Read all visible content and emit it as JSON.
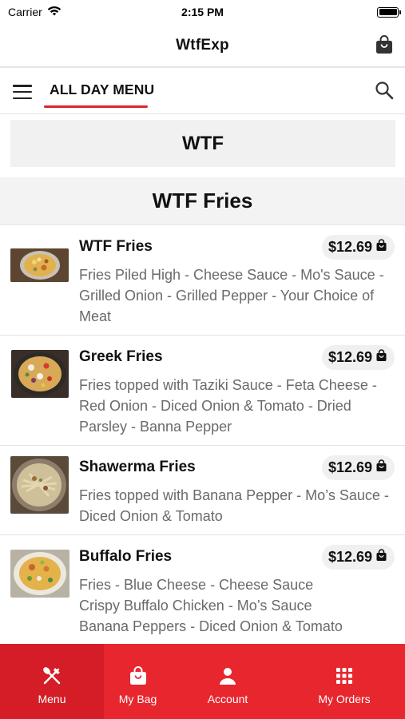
{
  "status_bar": {
    "carrier": "Carrier",
    "time": "2:15 PM",
    "battery_level": 1.0
  },
  "header": {
    "title": "WtfExp",
    "bag_icon": "shopping-bag-icon"
  },
  "menu_bar": {
    "menu_icon": "hamburger-icon",
    "tab_label": "ALL DAY MENU",
    "search_icon": "search-icon"
  },
  "category": {
    "title": "WTF"
  },
  "subcategory": {
    "title": "WTF Fries"
  },
  "items": [
    {
      "name": "WTF Fries",
      "price": "$12.69",
      "description": "Fries Piled High - Cheese Sauce - Mo's Sauce - Grilled Onion - Grilled Pepper - Your Choice of Meat"
    },
    {
      "name": "Greek Fries",
      "price": "$12.69",
      "description": "Fries topped with Taziki Sauce - Feta Cheese - Red Onion - Diced Onion & Tomato - Dried Parsley - Banna Pepper"
    },
    {
      "name": "Shawerma Fries",
      "price": "$12.69",
      "description": "Fries topped with Banana Pepper - Mo’s Sauce - Diced Onion & Tomato"
    },
    {
      "name": "Buffalo Fries",
      "price": "$12.69",
      "description_lines": [
        "Fries - Blue Cheese - Cheese Sauce",
        "Crispy Buffalo Chicken - Mo’s Sauce",
        "Banana Peppers - Diced Onion & Tomato"
      ]
    }
  ],
  "bottom_nav": [
    {
      "label": "Menu",
      "icon": "fork-knife-icon",
      "active": true
    },
    {
      "label": "My Bag",
      "icon": "shopping-bag-icon",
      "active": false
    },
    {
      "label": "Account",
      "icon": "person-icon",
      "active": false
    },
    {
      "label": "My Orders",
      "icon": "grid-icon",
      "active": false
    }
  ],
  "colors": {
    "accent": "#e8262e",
    "accent_active": "#d41d26",
    "section_bg": "#f1f1f1",
    "price_bg": "#f0f0f0",
    "description_text": "#6a6a6a"
  }
}
